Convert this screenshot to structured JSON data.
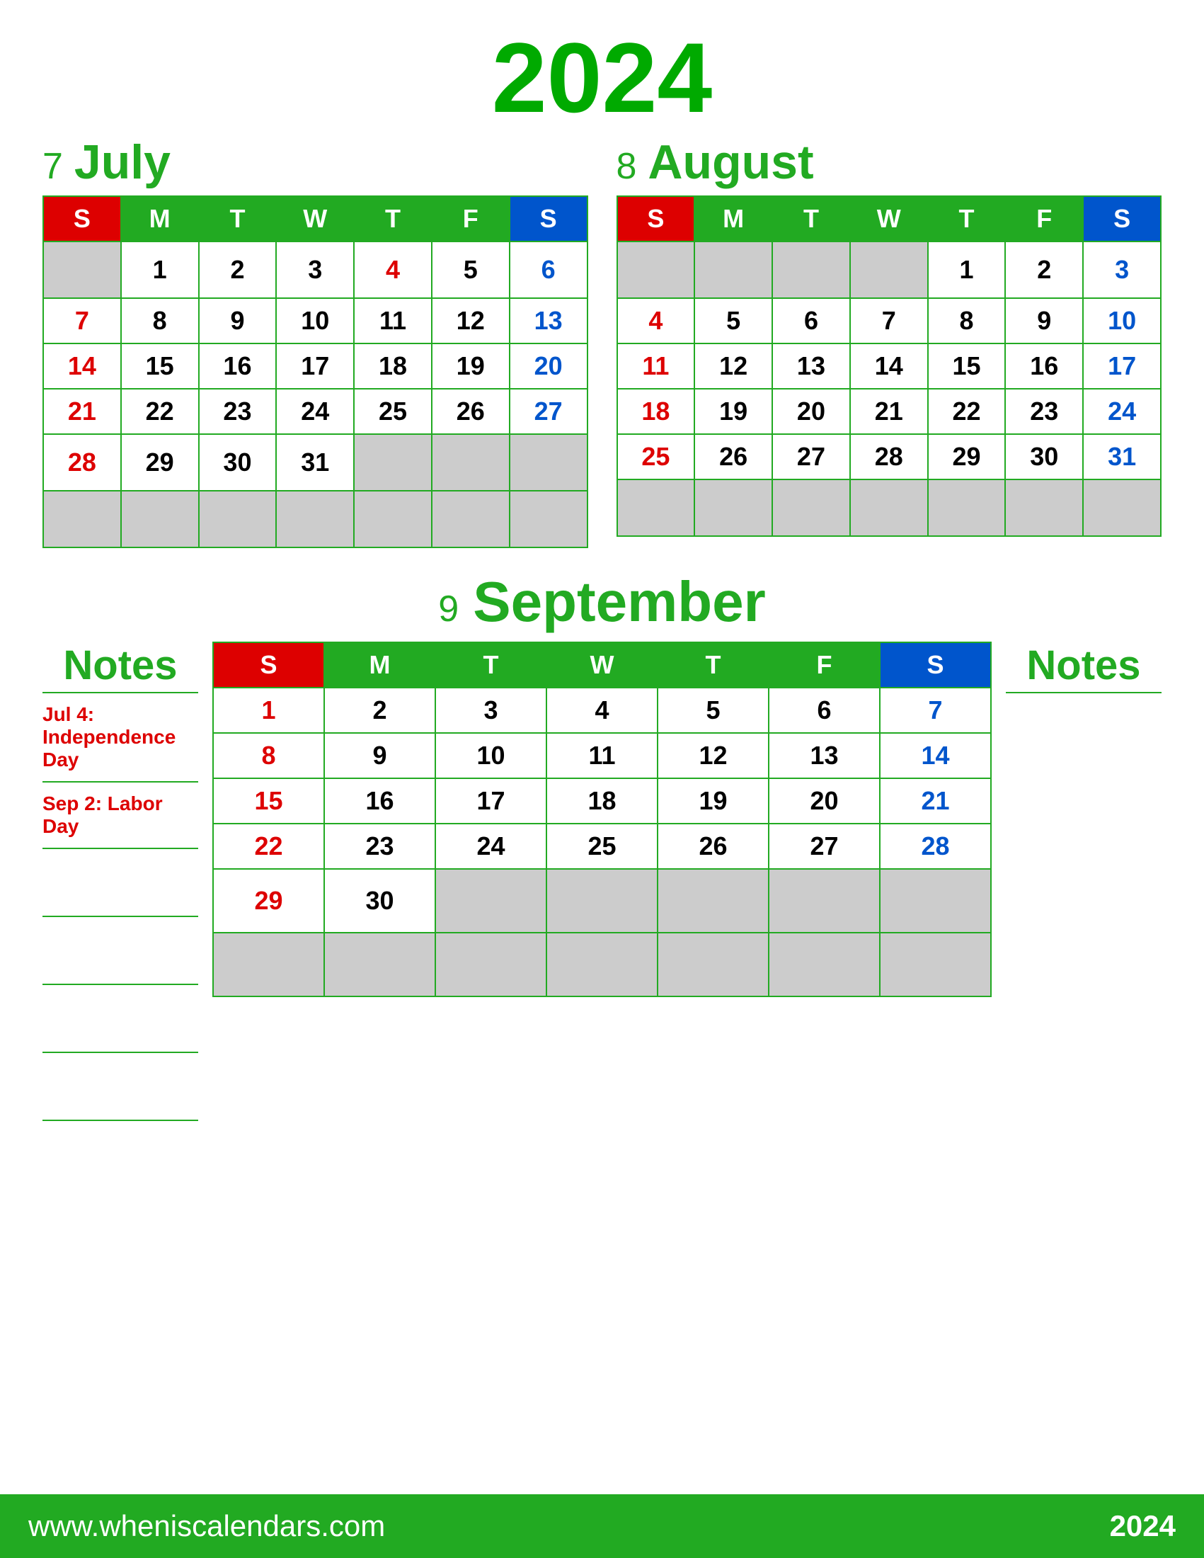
{
  "year": "2024",
  "footer": {
    "url": "www.wheniscalendars.com",
    "year": "2024"
  },
  "july": {
    "num": "7",
    "name": "July",
    "days_header": [
      "S",
      "M",
      "T",
      "W",
      "T",
      "F",
      "S"
    ],
    "weeks": [
      [
        "",
        "1",
        "2",
        "3",
        "4",
        "5",
        "6"
      ],
      [
        "7",
        "8",
        "9",
        "10",
        "11",
        "12",
        "13"
      ],
      [
        "14",
        "15",
        "16",
        "17",
        "18",
        "19",
        "20"
      ],
      [
        "21",
        "22",
        "23",
        "24",
        "25",
        "26",
        "27"
      ],
      [
        "28",
        "29",
        "30",
        "31",
        "",
        "",
        ""
      ],
      [
        "",
        "",
        "",
        "",
        "",
        "",
        ""
      ]
    ]
  },
  "august": {
    "num": "8",
    "name": "August",
    "days_header": [
      "S",
      "M",
      "T",
      "W",
      "T",
      "F",
      "S"
    ],
    "weeks": [
      [
        "",
        "",
        "",
        "",
        "1",
        "2",
        "3"
      ],
      [
        "4",
        "5",
        "6",
        "7",
        "8",
        "9",
        "10"
      ],
      [
        "11",
        "12",
        "13",
        "14",
        "15",
        "16",
        "17"
      ],
      [
        "18",
        "19",
        "20",
        "21",
        "22",
        "23",
        "24"
      ],
      [
        "25",
        "26",
        "27",
        "28",
        "29",
        "30",
        "31"
      ],
      [
        "",
        "",
        "",
        "",
        "",
        "",
        ""
      ]
    ]
  },
  "september": {
    "num": "9",
    "name": "September",
    "days_header": [
      "S",
      "M",
      "T",
      "W",
      "T",
      "F",
      "S"
    ],
    "weeks": [
      [
        "1",
        "2",
        "3",
        "4",
        "5",
        "6",
        "7"
      ],
      [
        "8",
        "9",
        "10",
        "11",
        "12",
        "13",
        "14"
      ],
      [
        "15",
        "16",
        "17",
        "18",
        "19",
        "20",
        "21"
      ],
      [
        "22",
        "23",
        "24",
        "25",
        "26",
        "27",
        "28"
      ],
      [
        "29",
        "30",
        "",
        "",
        "",
        "",
        ""
      ],
      [
        "",
        "",
        "",
        "",
        "",
        "",
        ""
      ]
    ]
  },
  "notes_left": {
    "title": "Notes",
    "items": [
      "Jul 4: Independence Day",
      "Sep 2: Labor Day",
      "",
      "",
      "",
      ""
    ]
  },
  "notes_right": {
    "title": "Notes"
  }
}
